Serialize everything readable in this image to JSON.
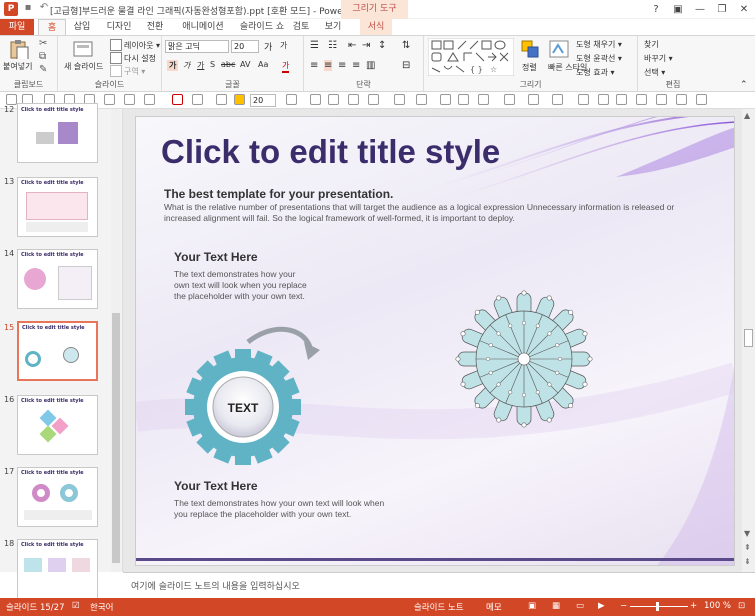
{
  "window": {
    "title": "[고급형]부드러운 물결 라인 그래픽(자동완성형포함).ppt [호환 모드] - PowerPoint",
    "context_tool": "그리기 도구",
    "controls": [
      "?",
      "▣",
      "—",
      "❐",
      "✕"
    ]
  },
  "ribbon_tabs": [
    "파일",
    "홈",
    "삽입",
    "디자인",
    "전환",
    "애니메이션",
    "슬라이드 쇼",
    "검토",
    "보기",
    "서식"
  ],
  "ribbon": {
    "clipboard": {
      "paste": "붙여넣기",
      "label": "클립보드"
    },
    "slides": {
      "new_slide": "새 슬라이드",
      "layout": "레이아웃 ▾",
      "reset": "다시 설정",
      "section": "구역 ▾",
      "label": "슬라이드"
    },
    "font": {
      "font_name": "맑은 고딕",
      "font_size": "20",
      "label": "글꼴",
      "buttons": [
        "가",
        "가",
        "가",
        "S",
        "abc",
        "AV",
        "Aa",
        "가"
      ]
    },
    "paragraph": {
      "label": "단락"
    },
    "drawing": {
      "arrange": "정렬",
      "quick_styles": "빠른\n스타일",
      "fill": "도형 채우기 ▾",
      "outline": "도형 윤곽선 ▾",
      "effects": "도형 효과 ▾",
      "label": "그리기"
    },
    "editing": {
      "find": "찾기",
      "replace": "바꾸기 ▾",
      "select": "선택 ▾",
      "label": "편집"
    }
  },
  "toolbar2": {
    "font_size": "20"
  },
  "thumbnails": [
    {
      "num": "12",
      "title": "Click to edit title style",
      "active": false
    },
    {
      "num": "13",
      "title": "Click to edit title style",
      "active": false
    },
    {
      "num": "14",
      "title": "Click to edit title style",
      "active": false
    },
    {
      "num": "15",
      "title": "Click to edit title style",
      "active": true
    },
    {
      "num": "16",
      "title": "Click to edit title style",
      "active": false
    },
    {
      "num": "17",
      "title": "Click to edit title style",
      "active": false
    },
    {
      "num": "18",
      "title": "Click to edit title style",
      "active": false
    }
  ],
  "slide": {
    "title": "Click to edit title style",
    "subtitle": "The best template for your presentation.",
    "intro_line1": "What is the relative number of presentations that will target the audience as a logical expression Unnecessary information is released or",
    "intro_line2": "increased alignment will fail. So the logical framework of well-formed, it is important to deploy.",
    "block1_heading": "Your Text Here",
    "block1_line1": "The text demonstrates how your",
    "block1_line2": "own text will look when you replace",
    "block1_line3": "the placeholder with your own text.",
    "gear_label": "TEXT",
    "block2_heading": "Your Text Here",
    "block2_line1": "The text demonstrates how your own text will look when",
    "block2_line2": "you replace the placeholder with your own text."
  },
  "notes_placeholder": "여기에 슬라이드 노트의 내용을 입력하십시오",
  "status": {
    "slide_info": "슬라이드 15/27",
    "language": "한국어",
    "notes": "슬라이드 노트",
    "comments": "메모",
    "zoom": "100 %"
  },
  "colors": {
    "accent": "#d24726",
    "title": "#3b2d6b",
    "gear": "#5fb3c4"
  }
}
